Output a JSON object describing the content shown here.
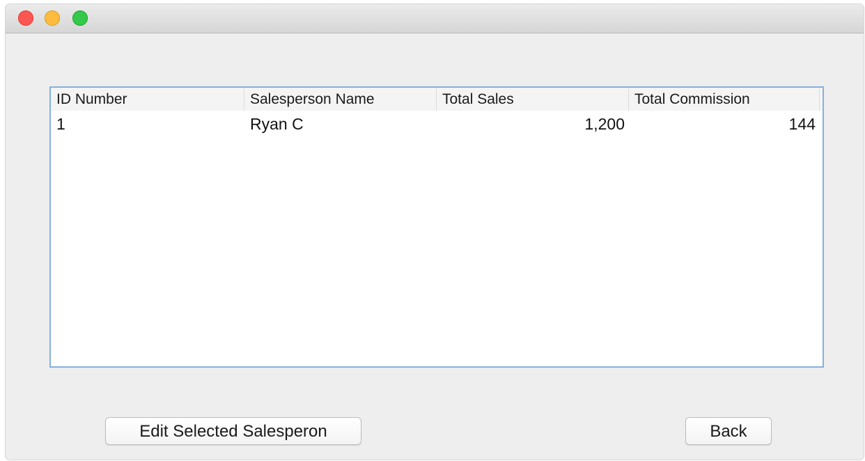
{
  "window": {
    "controls": [
      "close",
      "minimize",
      "zoom"
    ]
  },
  "table": {
    "columns": [
      "ID Number",
      "Salesperson Name",
      "Total Sales",
      "Total Commission"
    ],
    "rows": [
      [
        "1",
        "Ryan C",
        "1,200",
        "144"
      ]
    ]
  },
  "buttons": {
    "edit_label": "Edit Selected Salesperon",
    "back_label": "Back"
  },
  "colors": {
    "table_border": "#86b0dc",
    "close": "#fc5753",
    "minimize": "#fdbc40",
    "zoom": "#34c84a"
  }
}
